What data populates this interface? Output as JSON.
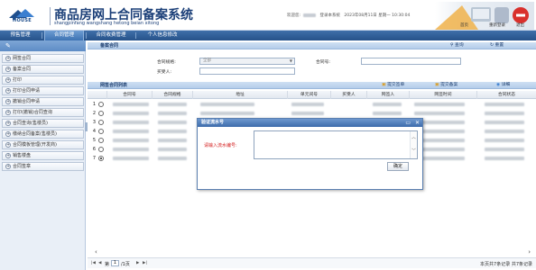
{
  "header": {
    "logo_text": "HOUSE",
    "title": "商品房网上合同备案系统",
    "pinyin": "shangpinfang wangshang hetong beian xitong",
    "welcome_prefix": "欢迎您:",
    "login_text": "登录本系统",
    "datetime": "2023年08月11日 星期一 10:30:04",
    "btn_home": "首页",
    "btn_relogin": "重新登录",
    "btn_exit": "退出"
  },
  "nav": {
    "items": [
      "预售管理",
      "合同管理",
      "合同收费管理",
      "个人信息修改"
    ],
    "active_index": 1
  },
  "sidebar": {
    "items": [
      "网签合同",
      "备案合同",
      "打印",
      "打印合同申请",
      "撤销合同申请",
      "打印(撤销)合同查询",
      "合同查询(售楼员)",
      "缴纳合同备案(售楼员)",
      "合同模板管理(开发商)",
      "销售楼盘",
      "合同签章"
    ]
  },
  "search_section": {
    "title": "备案合同",
    "query_btn": "查询",
    "reset_btn": "重置",
    "contract_type_label": "合同规格:",
    "contract_type_value": "全部",
    "contract_no_label": "合同号:",
    "buyer_label": "买受人:"
  },
  "list_section": {
    "title": "网签合同列表",
    "btn_submit": "提交签单",
    "btn_filing": "提交备案",
    "btn_detail": "详细",
    "columns": [
      "合同号",
      "合同规格",
      "地址",
      "单元间号",
      "买受人",
      "网签人",
      "网签时间",
      "合同状态"
    ],
    "row_numbers": [
      "1",
      "2",
      "3",
      "4",
      "5",
      "6",
      "7"
    ],
    "selected_row": 7
  },
  "pager": {
    "first": "|◀",
    "prev": "◀",
    "page_prefix": "第",
    "page_value": "1",
    "page_suffix": "/1页",
    "next": "▶",
    "last": "▶|",
    "summary": "本页共7条记录 共7条记录"
  },
  "dialog": {
    "title": "验证流水号",
    "label": "请输入流水编号:",
    "ok": "确定"
  }
}
